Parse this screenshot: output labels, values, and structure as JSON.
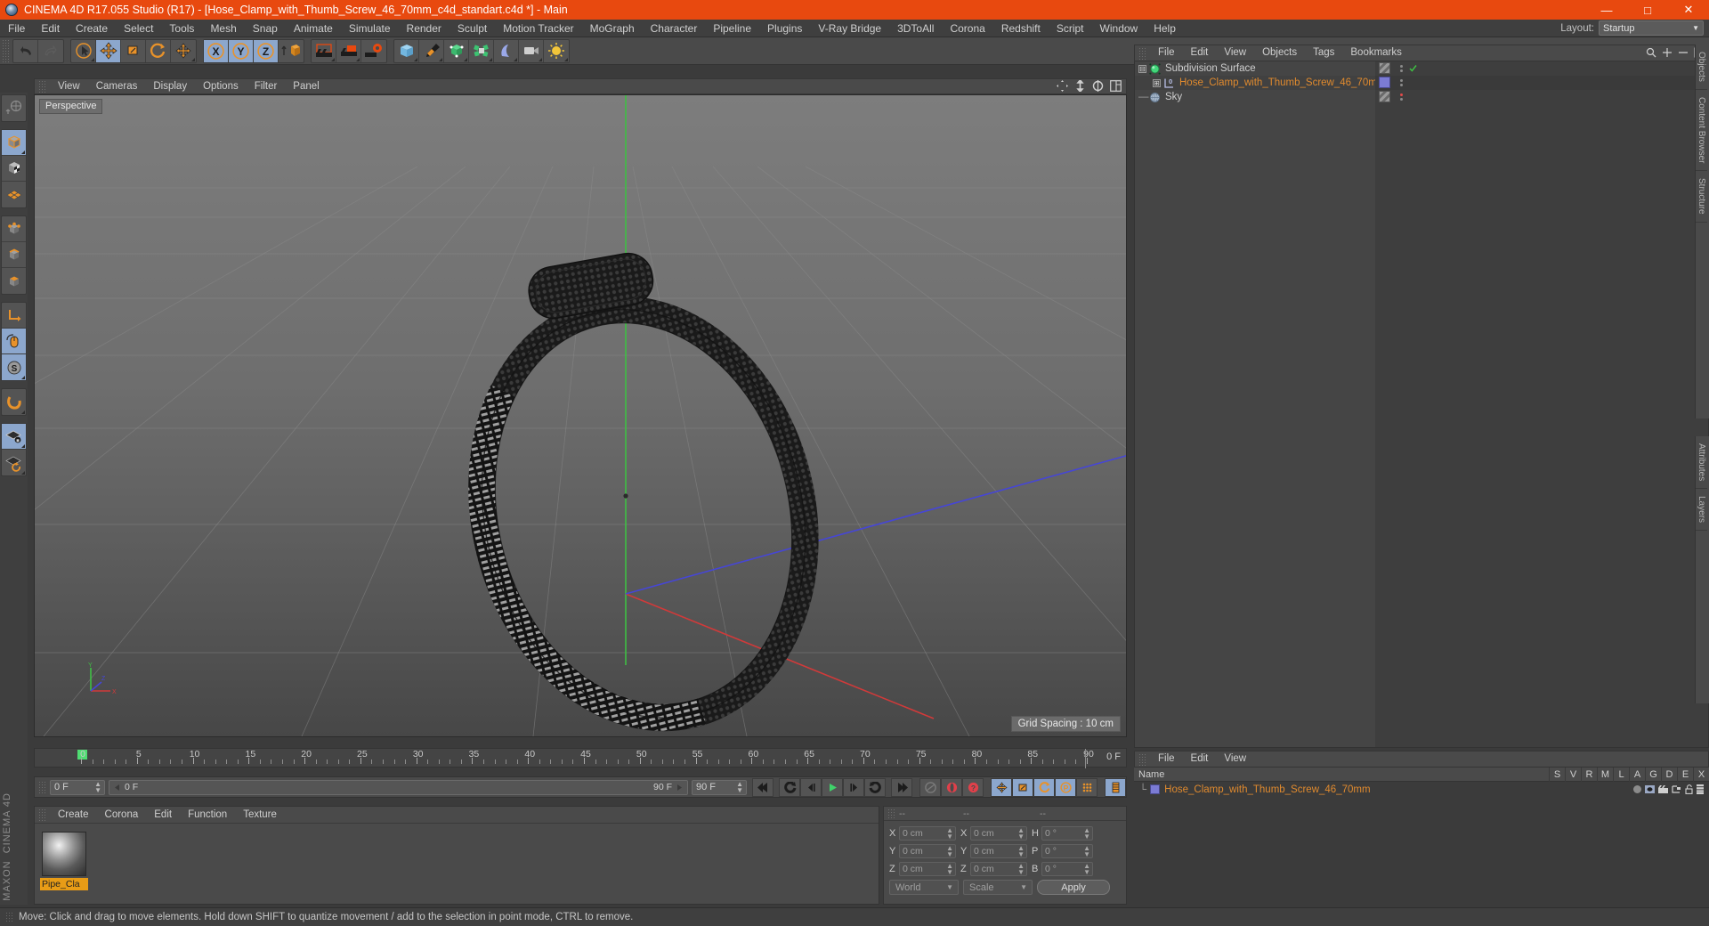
{
  "window": {
    "title": "CINEMA 4D R17.055 Studio (R17) - [Hose_Clamp_with_Thumb_Screw_46_70mm_c4d_standart.c4d *] - Main",
    "minimize": "—",
    "maximize": "□",
    "close": "✕"
  },
  "menubar": {
    "items": [
      "File",
      "Edit",
      "Create",
      "Select",
      "Tools",
      "Mesh",
      "Snap",
      "Animate",
      "Simulate",
      "Render",
      "Sculpt",
      "Motion Tracker",
      "MoGraph",
      "Character",
      "Pipeline",
      "Plugins",
      "V-Ray Bridge",
      "3DToAll",
      "Corona",
      "Redshift",
      "Script",
      "Window",
      "Help"
    ],
    "layout_label": "Layout:",
    "layout_value": "Startup"
  },
  "viewport": {
    "menu": [
      "View",
      "Cameras",
      "Display",
      "Options",
      "Filter",
      "Panel"
    ],
    "perspective_label": "Perspective",
    "grid_spacing": "Grid Spacing : 10 cm",
    "axis_x": "X",
    "axis_y": "Y",
    "axis_z": "Z"
  },
  "object_manager": {
    "menu": [
      "File",
      "Edit",
      "View",
      "Objects",
      "Tags",
      "Bookmarks"
    ],
    "objects": [
      {
        "name": "Subdivision Surface",
        "type": "subdivision-surface",
        "depth": 0,
        "selected": false
      },
      {
        "name": "Hose_Clamp_with_Thumb_Screw_46_70mm",
        "type": "polygon-object",
        "depth": 1,
        "selected": true
      },
      {
        "name": "Sky",
        "type": "sky-object",
        "depth": 0,
        "selected": false
      }
    ]
  },
  "right_tabs": [
    "Objects",
    "Content Browser",
    "Structure"
  ],
  "timeline": {
    "ticks": [
      0,
      5,
      10,
      15,
      20,
      25,
      30,
      35,
      40,
      45,
      50,
      55,
      60,
      65,
      70,
      75,
      80,
      85,
      90
    ],
    "current_frame_right": "0 F",
    "current_frame_field": "0 F",
    "preview_start": "0 F",
    "preview_end": "90 F",
    "max_frame": "90 F"
  },
  "material_manager": {
    "menu": [
      "Create",
      "Corona",
      "Edit",
      "Function",
      "Texture"
    ],
    "materials": [
      {
        "name": "Pipe_Cla"
      }
    ]
  },
  "coordinates": {
    "headers": [
      "--",
      "--",
      "--"
    ],
    "position": {
      "label_x": "X",
      "label_y": "Y",
      "label_z": "Z",
      "x": "0 cm",
      "y": "0 cm",
      "z": "0 cm"
    },
    "size": {
      "label_x": "X",
      "label_y": "Y",
      "label_z": "Z",
      "x": "0 cm",
      "y": "0 cm",
      "z": "0 cm"
    },
    "rotation": {
      "label_h": "H",
      "label_p": "P",
      "label_b": "B",
      "h": "0 °",
      "p": "0 °",
      "b": "0 °"
    },
    "system": "World",
    "mode": "Scale",
    "apply": "Apply"
  },
  "attribute_manager": {
    "menu": [
      "File",
      "Edit",
      "View"
    ],
    "name_header": "Name",
    "columns": [
      "S",
      "V",
      "R",
      "M",
      "L",
      "A",
      "G",
      "D",
      "E",
      "X"
    ],
    "rows": [
      {
        "name": "Hose_Clamp_with_Thumb_Screw_46_70mm"
      }
    ]
  },
  "statusbar": {
    "message": "Move: Click and drag to move elements. Hold down SHIFT to quantize movement / add to the selection in point mode, CTRL to remove."
  },
  "branding": {
    "maxon": "MAXON",
    "c4d": "CINEMA 4D"
  },
  "colors": {
    "title_bar": "#e8490f",
    "accent_orange": "#e8922a",
    "selected_blue": "#8ca7cd",
    "selected_text": "#e08a2e",
    "panel_bg": "#3b3b3b",
    "toolbar_bg": "#4a4a4a",
    "material_swatch_purple": "#7b7bd4"
  }
}
